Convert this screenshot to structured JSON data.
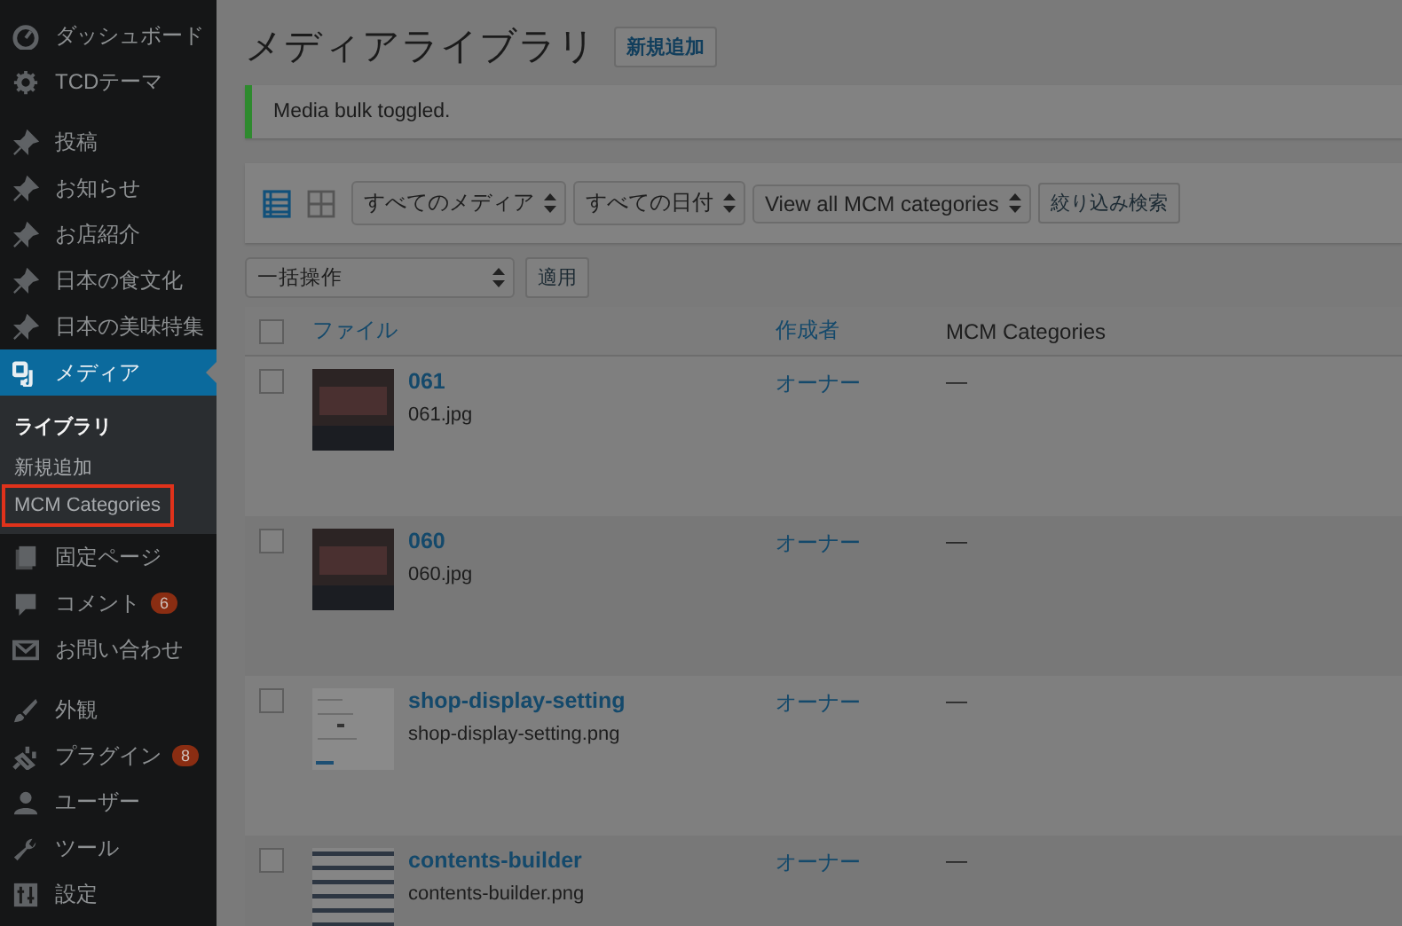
{
  "sidebar": {
    "menu_groups": [
      {
        "items": [
          {
            "label": "ダッシュボード",
            "selected": false
          },
          {
            "label": "TCDテーマ",
            "selected": false
          }
        ]
      },
      {
        "items": [
          {
            "label": "投稿",
            "selected": false
          },
          {
            "label": "お知らせ",
            "selected": false
          },
          {
            "label": "お店紹介",
            "selected": false
          },
          {
            "label": "日本の食文化",
            "selected": false
          },
          {
            "label": "日本の美味特集",
            "selected": false
          },
          {
            "label": "メディア",
            "selected": true,
            "children": [
              {
                "label": "ライブラリ",
                "selected": true,
                "highlighted": false
              },
              {
                "label": "新規追加",
                "selected": false,
                "highlighted": false
              },
              {
                "label": "MCM Categories",
                "selected": false,
                "highlighted": true
              }
            ]
          },
          {
            "label": "固定ページ",
            "selected": false
          },
          {
            "label": "コメント",
            "selected": false,
            "badge": "6"
          },
          {
            "label": "お問い合わせ",
            "selected": false
          }
        ]
      },
      {
        "items": [
          {
            "label": "外観",
            "selected": false
          },
          {
            "label": "プラグイン",
            "selected": false,
            "badge": "8"
          },
          {
            "label": "ユーザー",
            "selected": false
          },
          {
            "label": "ツール",
            "selected": false
          },
          {
            "label": "設定",
            "selected": false
          }
        ]
      }
    ]
  },
  "page": {
    "title": "メディアライブラリ",
    "add_button": "新規追加"
  },
  "notice": {
    "text": "Media bulk toggled."
  },
  "filter_bar": {
    "view_modes": [
      {
        "selected": true
      },
      {
        "selected": false
      }
    ],
    "filters": [
      {
        "value": "すべてのメディア"
      },
      {
        "value": "すべての日付"
      },
      {
        "value": "View all MCM categories"
      }
    ],
    "button": "絞り込み検索"
  },
  "bulk_actions": {
    "value": "一括操作",
    "button": "適用"
  },
  "table": {
    "select_all": {
      "checked": false
    },
    "columns": [
      {
        "label": "ファイル",
        "sortable": true
      },
      {
        "label": "作成者",
        "sortable": true
      },
      {
        "label": "MCM Categories",
        "sortable": false
      }
    ],
    "rows": [
      {
        "checked": false,
        "kind": "photo",
        "title": "061",
        "filename": "061.jpg",
        "author": "オーナー",
        "categories": "—"
      },
      {
        "checked": false,
        "kind": "photo",
        "title": "060",
        "filename": "060.jpg",
        "author": "オーナー",
        "categories": "—"
      },
      {
        "checked": false,
        "kind": "screenshot",
        "title": "shop-display-setting",
        "filename": "shop-display-setting.png",
        "author": "オーナー",
        "categories": "—"
      },
      {
        "checked": false,
        "kind": "lines",
        "title": "contents-builder",
        "filename": "contents-builder.png",
        "author": "オーナー",
        "categories": "—"
      }
    ]
  }
}
